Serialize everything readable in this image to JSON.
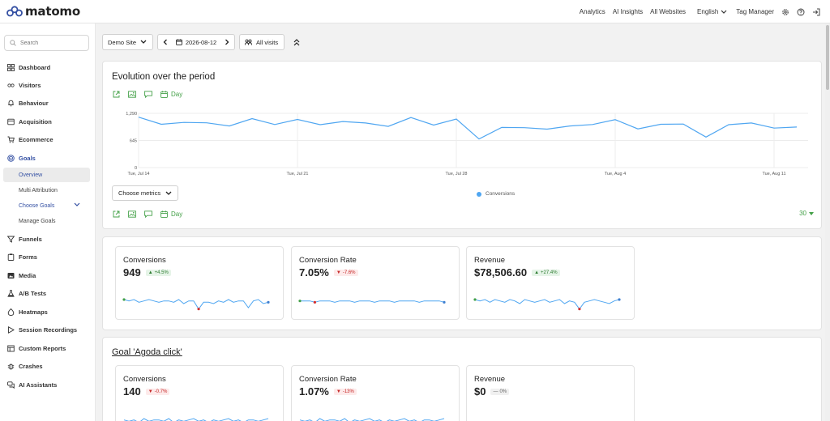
{
  "brand": {
    "name": "matomo"
  },
  "topnav": {
    "items": [
      "Analytics",
      "AI Insights",
      "All Websites"
    ],
    "language": "English",
    "tag_manager": "Tag Manager",
    "icons": [
      "gear-icon",
      "help-icon",
      "logout-icon"
    ]
  },
  "sidebar": {
    "search_placeholder": "Search",
    "items": {
      "dashboard": "Dashboard",
      "visitors": "Visitors",
      "behaviour": "Behaviour",
      "acquisition": "Acquisition",
      "ecommerce": "Ecommerce",
      "goals": "Goals",
      "funnels": "Funnels",
      "forms": "Forms",
      "media": "Media",
      "ab_tests": "A/B Tests",
      "heatmaps": "Heatmaps",
      "session_recordings": "Session Recordings",
      "custom_reports": "Custom Reports",
      "crashes": "Crashes",
      "ai_assistants": "AI Assistants"
    },
    "goals_sub": {
      "overview": "Overview",
      "multi_attribution": "Multi Attribution",
      "choose_goals": "Choose Goals",
      "manage_goals": "Manage Goals"
    }
  },
  "controls": {
    "site": "Demo Site",
    "date": "2026-08-12",
    "segment": "All visits"
  },
  "evolution": {
    "title": "Evolution over the period",
    "period_label": "Day",
    "choose_metrics": "Choose metrics",
    "limit": "30"
  },
  "chart_data": {
    "type": "line",
    "title": "",
    "series": [
      {
        "name": "Conversions",
        "color": "#4fa6f1",
        "values": [
          1200,
          1030,
          1075,
          1065,
          990,
          1165,
          1025,
          1145,
          1020,
          1095,
          1060,
          980,
          1190,
          1010,
          1155,
          680,
          955,
          950,
          915,
          990,
          1025,
          1140,
          920,
          1030,
          1035,
          725,
          1020,
          1060,
          940,
          965
        ]
      }
    ],
    "x_ticks": [
      "Tue, Jul 14",
      "Tue, Jul 21",
      "Tue, Jul 28",
      "Tue, Aug 4",
      "Tue, Aug 11"
    ],
    "x_tick_indices": [
      0,
      7,
      14,
      21,
      28
    ],
    "y_ticks": [
      "1,290",
      "645",
      "0"
    ],
    "ylim": [
      0,
      1290
    ],
    "legend": "bottom-center"
  },
  "overview_cards": [
    {
      "title": "Conversions",
      "value": "949",
      "change": "+4.5%",
      "trend": "up",
      "spark": [
        11,
        12,
        11,
        13,
        12,
        11,
        12,
        13,
        12,
        12,
        13,
        11,
        14,
        12,
        12,
        18,
        13,
        13,
        14,
        12,
        13,
        11,
        13,
        12,
        12,
        17,
        12,
        11,
        14,
        13
      ]
    },
    {
      "title": "Conversion Rate",
      "value": "7.05%",
      "change": "-7.6%",
      "trend": "down",
      "spark": [
        12,
        12,
        12,
        13,
        12,
        12,
        12,
        13,
        12,
        12,
        12,
        13,
        12,
        12,
        12,
        13,
        12,
        12,
        12,
        13,
        12,
        12,
        12,
        12,
        13,
        12,
        12,
        12,
        12,
        13
      ]
    },
    {
      "title": "Revenue",
      "value": "$78,506.60",
      "change": "+27.4%",
      "trend": "up",
      "spark": [
        11,
        12,
        11,
        13,
        11,
        12,
        13,
        11,
        12,
        14,
        11,
        12,
        13,
        12,
        11,
        13,
        12,
        11,
        14,
        12,
        13,
        18,
        13,
        12,
        11,
        12,
        13,
        14,
        12,
        11
      ]
    }
  ],
  "goal": {
    "title": "Goal 'Agoda click'",
    "cards": [
      {
        "title": "Conversions",
        "value": "140",
        "change": "-0.7%",
        "trend": "down"
      },
      {
        "title": "Conversion Rate",
        "value": "1.07%",
        "change": "-13%",
        "trend": "down"
      },
      {
        "title": "Revenue",
        "value": "$0",
        "change": "0%",
        "trend": "flat"
      }
    ]
  }
}
